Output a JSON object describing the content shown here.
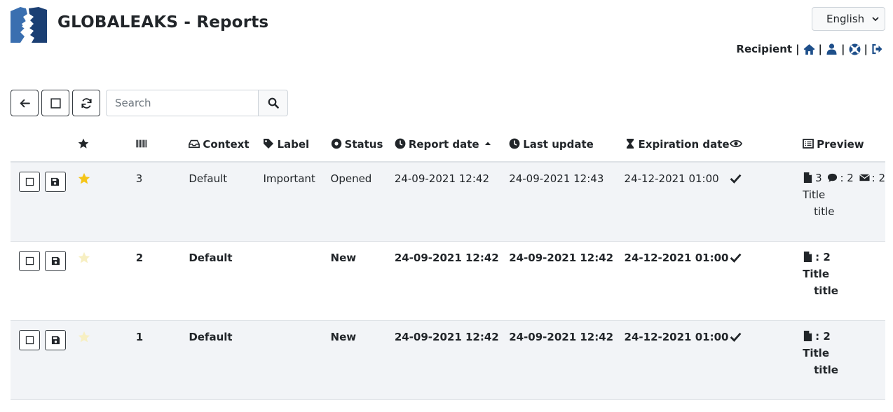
{
  "header": {
    "app_title": "GLOBALEAKS - Reports",
    "logo_icon": "globaleaks-logo-icon",
    "language": "English"
  },
  "usernav": {
    "role": "Recipient",
    "separator": "|",
    "icons": [
      "home-icon",
      "user-icon",
      "support-icon",
      "logout-icon"
    ]
  },
  "toolbar": {
    "buttons": [
      "back-arrow-icon",
      "select-all-checkbox-icon",
      "refresh-icon"
    ],
    "search_placeholder": "Search",
    "search_icon": "search-icon"
  },
  "table": {
    "columns": {
      "important": "",
      "id": "",
      "context": "Context",
      "label": "Label",
      "status": "Status",
      "report_date": "Report date",
      "last_update": "Last update",
      "expiration_date": "Expiration date",
      "seen": "",
      "preview": "Preview"
    },
    "rows": [
      {
        "id": "3",
        "important": true,
        "context": "Default",
        "label": "Important",
        "status": "Opened",
        "report_date": "24-09-2021 12:42",
        "last_update": "24-09-2021 12:43",
        "expiration_date": "24-12-2021 01:00",
        "seen": true,
        "files": "3",
        "comments": "2",
        "messages": "2",
        "preview_title": "Title",
        "preview_value": "title",
        "unread": false
      },
      {
        "id": "2",
        "important": false,
        "context": "Default",
        "label": "",
        "status": "New",
        "report_date": "24-09-2021 12:42",
        "last_update": "24-09-2021 12:42",
        "expiration_date": "24-12-2021 01:00",
        "seen": true,
        "files": "2",
        "preview_title": "Title",
        "preview_value": "title",
        "unread": true
      },
      {
        "id": "1",
        "important": false,
        "context": "Default",
        "label": "",
        "status": "New",
        "report_date": "24-09-2021 12:42",
        "last_update": "24-09-2021 12:42",
        "expiration_date": "24-12-2021 01:00",
        "seen": true,
        "files": "2",
        "preview_title": "Title",
        "preview_value": "title",
        "unread": true
      }
    ]
  },
  "colors": {
    "accent": "#1e4f8a",
    "star_on": "#f5c518",
    "star_off": "#f7efc2",
    "row_alt": "#f2f4f7"
  }
}
